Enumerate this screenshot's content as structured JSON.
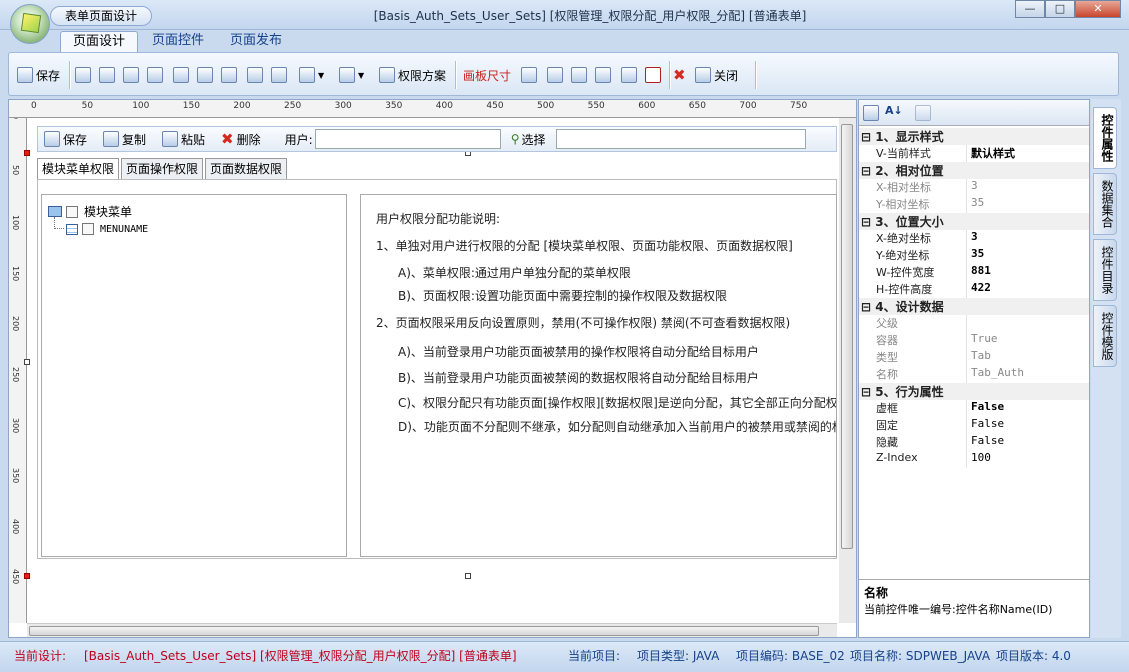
{
  "app": {
    "qat_title": "表单页面设计",
    "window_title": "[Basis_Auth_Sets_User_Sets] [权限管理_权限分配_用户权限_分配] [普通表单]",
    "win_minimize": "—",
    "win_maximize": "□",
    "win_close": "✕"
  },
  "ribbon_tabs": [
    "页面设计",
    "页面控件",
    "页面发布"
  ],
  "toolbar": {
    "save": "保存",
    "perm_scheme": "权限方案",
    "canvas_size": "画板尺寸",
    "close": "关闭"
  },
  "ruler": {
    "top": [
      "0",
      "50",
      "100",
      "150",
      "200",
      "250",
      "300",
      "350",
      "400",
      "450",
      "500",
      "550",
      "600",
      "650",
      "700",
      "750"
    ],
    "left": [
      "0",
      "50",
      "100",
      "150",
      "200",
      "250",
      "300",
      "350",
      "400",
      "450"
    ]
  },
  "form_toolbar": {
    "save": "保存",
    "copy": "复制",
    "paste": "粘贴",
    "delete": "删除",
    "user_label": "用户:",
    "user_value": "",
    "select": "选择"
  },
  "content_tabs": [
    "模块菜单权限",
    "页面操作权限",
    "页面数据权限"
  ],
  "tree": {
    "root": "模块菜单",
    "child": "MENUNAME"
  },
  "info_lines": [
    "用户权限分配功能说明:",
    "1、单独对用户进行权限的分配 [模块菜单权限、页面功能权限、页面数据权限]",
    "A)、菜单权限:通过用户单独分配的菜单权限",
    "B)、页面权限:设置功能页面中需要控制的操作权限及数据权限",
    "2、页面权限采用反向设置原则，禁用(不可操作权限)  禁阅(不可查看数据权限)",
    "A)、当前登录用户功能页面被禁用的操作权限将自动分配给目标用户",
    "B)、当前登录用户功能页面被禁阅的数据权限将自动分配给目标用户",
    "C)、权限分配只有功能页面[操作权限][数据权限]是逆向分配，其它全部正向分配权",
    "D)、功能页面不分配则不继承，如分配则自动继承加入当前用户的被禁用或禁阅的权"
  ],
  "properties": {
    "groups": [
      {
        "title": "1、显示样式",
        "rows": [
          {
            "k": "V-当前样式",
            "v": "默认样式",
            "style": "bold"
          }
        ]
      },
      {
        "title": "2、相对位置",
        "rows": [
          {
            "k": "X-相对坐标",
            "v": "3",
            "style": "dim"
          },
          {
            "k": "Y-相对坐标",
            "v": "35",
            "style": "dim"
          }
        ]
      },
      {
        "title": "3、位置大小",
        "rows": [
          {
            "k": "X-绝对坐标",
            "v": "3",
            "style": "bold"
          },
          {
            "k": "Y-绝对坐标",
            "v": "35",
            "style": "bold"
          },
          {
            "k": "W-控件宽度",
            "v": "881",
            "style": "bold"
          },
          {
            "k": "H-控件高度",
            "v": "422",
            "style": "bold"
          }
        ]
      },
      {
        "title": "4、设计数据",
        "rows": [
          {
            "k": "父级",
            "v": "",
            "style": "dim"
          },
          {
            "k": "容器",
            "v": "True",
            "style": "dim"
          },
          {
            "k": "类型",
            "v": "Tab",
            "style": "dim"
          },
          {
            "k": "名称",
            "v": "Tab_Auth",
            "style": "dim"
          }
        ]
      },
      {
        "title": "5、行为属性",
        "rows": [
          {
            "k": "虚框",
            "v": "False",
            "style": "bold"
          },
          {
            "k": "固定",
            "v": "False",
            "style": "normal"
          },
          {
            "k": "隐藏",
            "v": "False",
            "style": "normal"
          },
          {
            "k": "Z-Index",
            "v": "100",
            "style": "normal"
          }
        ]
      }
    ],
    "desc_title": "名称",
    "desc_text": "当前控件唯一编号:控件名称Name(ID)"
  },
  "side_tabs": [
    "控件属性",
    "数据集合",
    "控件目录",
    "控件模版"
  ],
  "status": {
    "design_label": "当前设计:",
    "design_value": "[Basis_Auth_Sets_User_Sets] [权限管理_权限分配_用户权限_分配] [普通表单]",
    "project_label": "当前项目:",
    "type": "项目类型: JAVA",
    "code": "项目编码: BASE_02",
    "name": "项目名称: SDPWEB_JAVA",
    "version": "项目版本: 4.0"
  },
  "colors": {
    "status_red": "#c0001a",
    "status_blue": "#15428b",
    "ribbon_red": "#c81e1e"
  }
}
